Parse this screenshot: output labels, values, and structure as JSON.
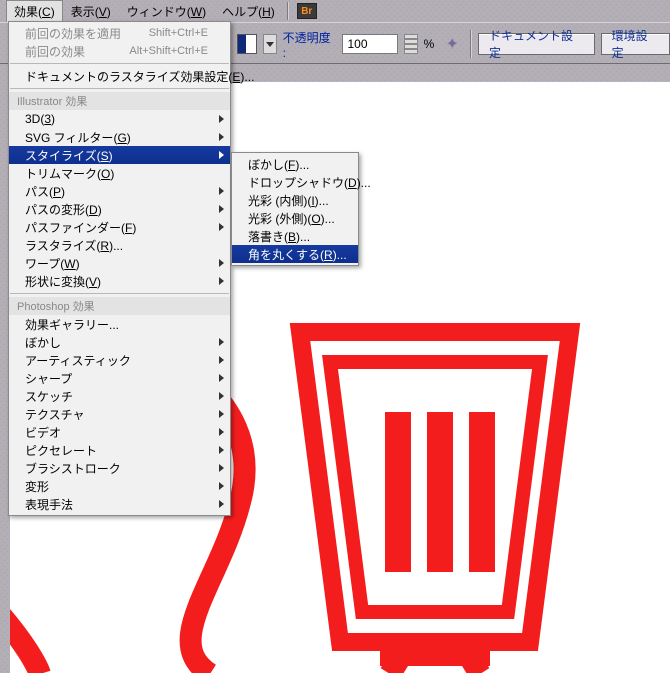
{
  "menubar": {
    "items": [
      {
        "label": "効果",
        "accel": "C",
        "active": true
      },
      {
        "label": "表示",
        "accel": "V"
      },
      {
        "label": "ウィンドウ",
        "accel": "W"
      },
      {
        "label": "ヘルプ",
        "accel": "H"
      }
    ],
    "br": "Br"
  },
  "toolbar": {
    "opacity_label": "不透明度 :",
    "opacity_value": "100",
    "pct": "%",
    "doc_settings": "ドキュメント設定",
    "env_settings": "環境設定"
  },
  "menu1": {
    "top": [
      {
        "label": "前回の効果を適用",
        "accel": "Shift+Ctrl+E",
        "disabled": true
      },
      {
        "label": "前回の効果",
        "accel": "Alt+Shift+Ctrl+E",
        "disabled": true
      }
    ],
    "raster": {
      "label": "ドキュメントのラスタライズ効果設定",
      "accel": "E"
    },
    "section1": "Illustrator 効果",
    "ai": [
      {
        "label": "3D",
        "accel": "3",
        "sub": true
      },
      {
        "label": "SVG フィルター",
        "accel": "G",
        "sub": true
      },
      {
        "label": "スタイライズ",
        "accel": "S",
        "sub": true,
        "selected": true
      },
      {
        "label": "トリムマーク",
        "accel": "O"
      },
      {
        "label": "パス",
        "accel": "P",
        "sub": true
      },
      {
        "label": "パスの変形",
        "accel": "D",
        "sub": true
      },
      {
        "label": "パスファインダー",
        "accel": "F",
        "sub": true
      },
      {
        "label": "ラスタライズ",
        "accel": "R"
      },
      {
        "label": "ワープ",
        "accel": "W",
        "sub": true
      },
      {
        "label": "形状に変換",
        "accel": "V",
        "sub": true
      }
    ],
    "section2": "Photoshop 効果",
    "ps": [
      {
        "label": "効果ギャラリー..."
      },
      {
        "label": "ぼかし",
        "sub": true
      },
      {
        "label": "アーティスティック",
        "sub": true
      },
      {
        "label": "シャープ",
        "sub": true
      },
      {
        "label": "スケッチ",
        "sub": true
      },
      {
        "label": "テクスチャ",
        "sub": true
      },
      {
        "label": "ビデオ",
        "sub": true
      },
      {
        "label": "ピクセレート",
        "sub": true
      },
      {
        "label": "ブラシストローク",
        "sub": true
      },
      {
        "label": "変形",
        "sub": true
      },
      {
        "label": "表現手法",
        "sub": true
      }
    ]
  },
  "menu2": {
    "items": [
      {
        "label": "ぼかし",
        "accel": "F"
      },
      {
        "label": "ドロップシャドウ",
        "accel": "D"
      },
      {
        "label": "光彩 (内側)",
        "accel": "I"
      },
      {
        "label": "光彩 (外側)",
        "accel": "O"
      },
      {
        "label": "落書き",
        "accel": "B"
      },
      {
        "label": "角を丸くする",
        "accel": "R",
        "selected": true
      }
    ]
  }
}
